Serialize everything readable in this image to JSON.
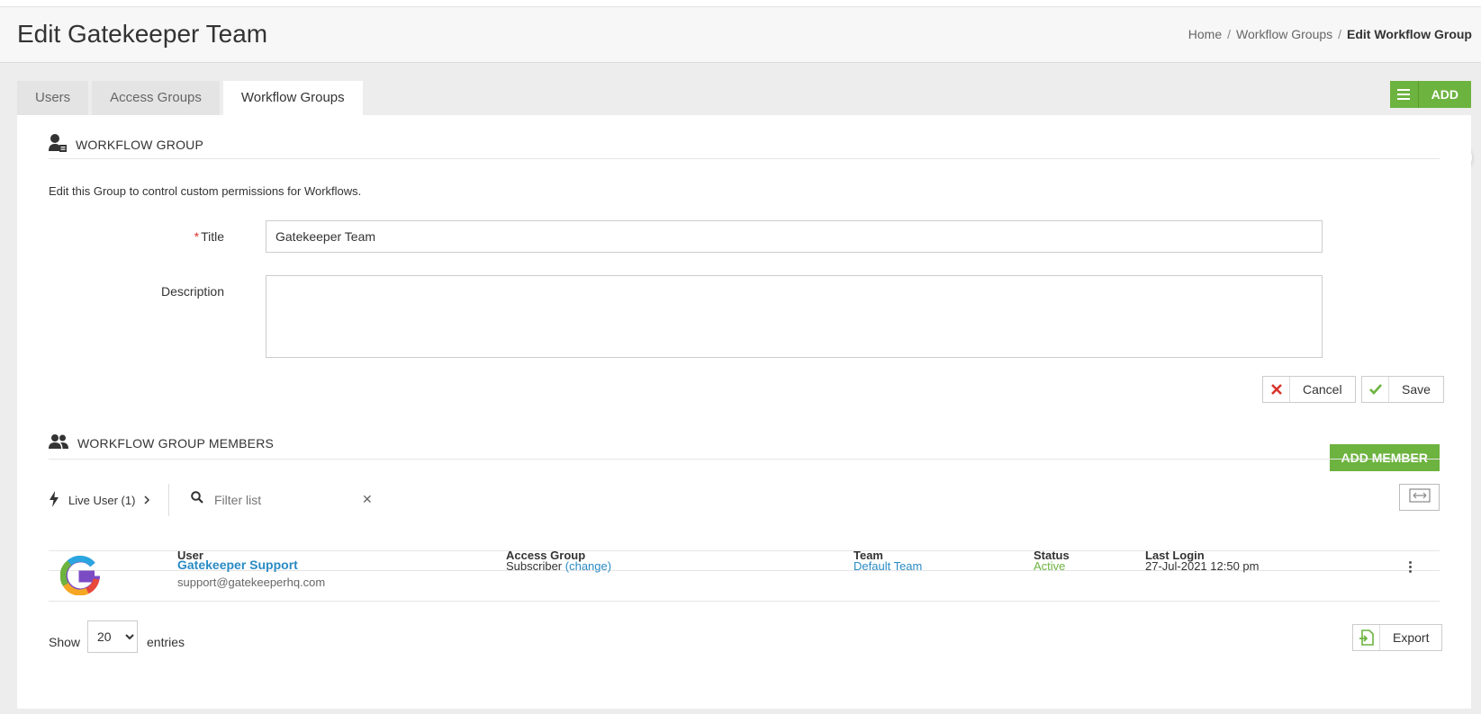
{
  "header": {
    "title": "Edit Gatekeeper Team",
    "breadcrumb": [
      "Home",
      "Workflow Groups",
      "Edit Workflow Group"
    ]
  },
  "tabs": [
    {
      "label": "Users",
      "active": false
    },
    {
      "label": "Access Groups",
      "active": false
    },
    {
      "label": "Workflow Groups",
      "active": true
    }
  ],
  "toolbar": {
    "add_label": "ADD"
  },
  "workflow_group": {
    "section_title": "WORKFLOW GROUP",
    "description": "Edit this Group to control custom permissions for Workflows.",
    "title_label": "Title",
    "title_value": "Gatekeeper Team",
    "description_label": "Description",
    "description_value": "",
    "cancel_label": "Cancel",
    "save_label": "Save"
  },
  "members": {
    "section_title": "WORKFLOW GROUP MEMBERS",
    "add_member_label": "ADD MEMBER",
    "live_user_label": "Live User (1)",
    "filter_placeholder": "Filter list",
    "columns": [
      "User",
      "Access Group",
      "Team",
      "Status",
      "Last Login"
    ],
    "rows": [
      {
        "name": "Gatekeeper Support",
        "email": "support@gatekeeperhq.com",
        "access_group": "Subscriber",
        "change_label": "(change)",
        "team": "Default Team",
        "status": "Active",
        "last_login": "27-Jul-2021 12:50 pm"
      }
    ],
    "show_label": "Show",
    "entries_value": "20",
    "entries_label": "entries",
    "export_label": "Export"
  },
  "colors": {
    "accent_green": "#6db33f",
    "link_blue": "#2a8bc4",
    "danger_red": "#d9342b"
  }
}
